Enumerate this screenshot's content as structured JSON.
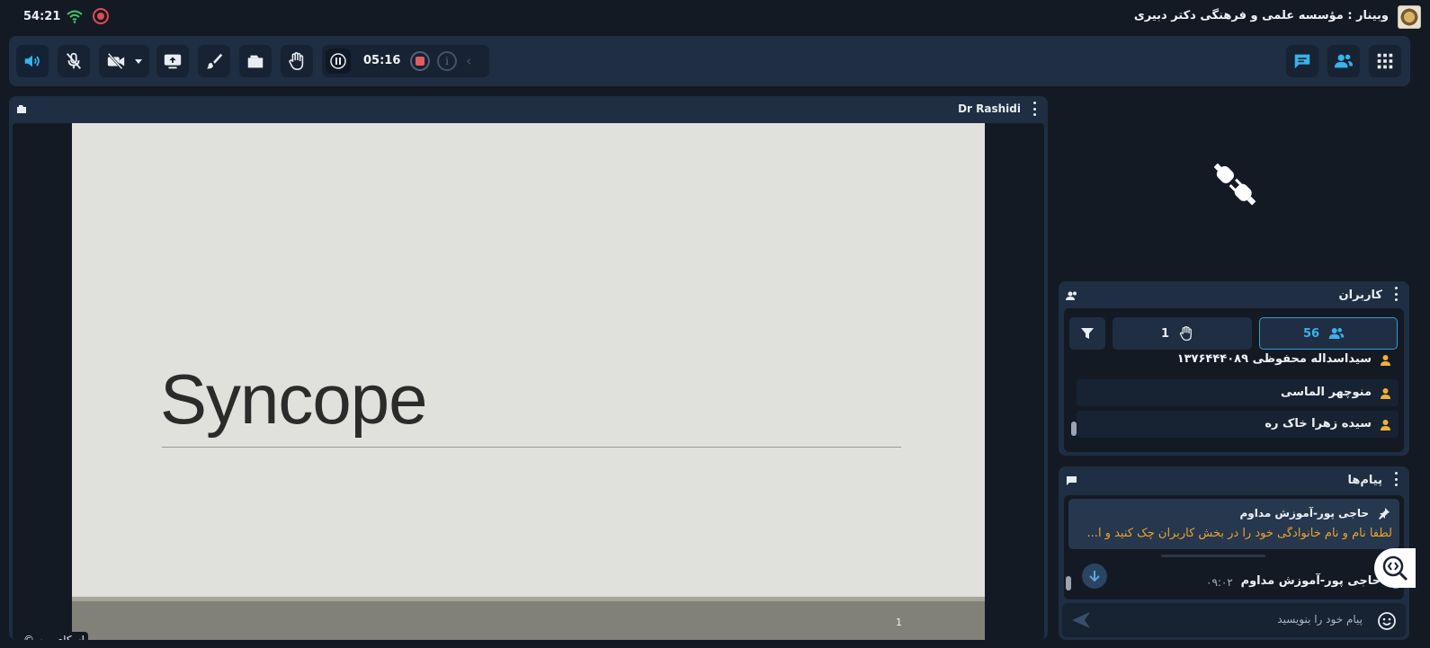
{
  "status_bar": {
    "clock": "54:21",
    "title": "وبینار : مؤسسه علمی و فرهنگی دکتر دبیری"
  },
  "toolbar": {
    "timer": "05:16",
    "info_label": "i"
  },
  "stage": {
    "presenter": "Dr Rashidi",
    "slide_title": "Syncope",
    "page_number": "1",
    "copyright": "اسکای‌روم ©"
  },
  "users_panel": {
    "title": "کاربران",
    "user_count": "56",
    "raised_hands": "1",
    "users": [
      {
        "name": "سیداسداله محفوظی ۱۳۷۶۴۴۴۰۸۹"
      },
      {
        "name": "منوچهر الماسی"
      },
      {
        "name": "سیده زهرا خاک ره"
      }
    ]
  },
  "messages_panel": {
    "title": "پیام‌ها",
    "pinned": {
      "sender": "حاجی پور-آموزش مداوم",
      "text": "لطفا نام و نام خانوادگی خود را در بخش کاربران چک کنید و ا..."
    },
    "last_message": {
      "sender": "حاجی پور-آموزش مداوم",
      "time": "۰۹:۰۲"
    },
    "composer_placeholder": "پیام خود را بنویسید"
  },
  "colors": {
    "accent": "#38b2ec",
    "panel": "#1f2e42",
    "background": "#131a24",
    "recording": "#e14b53",
    "pinned_text": "#e9a52c"
  }
}
